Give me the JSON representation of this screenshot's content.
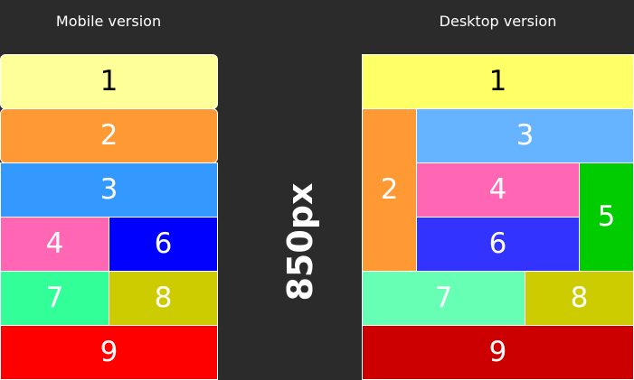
{
  "titles": {
    "mobile": "Mobile version",
    "desktop": "Desktop version"
  },
  "breakpoint": "850px",
  "mobile": {
    "cells": [
      {
        "label": "1",
        "color": "#ffff99"
      },
      {
        "label": "2",
        "color": "#ff9933"
      },
      {
        "label": "3",
        "color": "#3399ff"
      },
      {
        "label": "4",
        "color": "#ff66b3"
      },
      {
        "label": "6",
        "color": "#0000ff"
      },
      {
        "label": "7",
        "color": "#33ff99"
      },
      {
        "label": "8",
        "color": "#cccc00"
      },
      {
        "label": "9",
        "color": "#ff0000"
      }
    ]
  },
  "desktop": {
    "cells": [
      {
        "label": "1",
        "color": "#ffff66"
      },
      {
        "label": "2",
        "color": "#ff9933"
      },
      {
        "label": "3",
        "color": "#66b3ff"
      },
      {
        "label": "4",
        "color": "#ff66b3"
      },
      {
        "label": "5",
        "color": "#00cc00"
      },
      {
        "label": "6",
        "color": "#3333ff"
      },
      {
        "label": "7",
        "color": "#66ffb3"
      },
      {
        "label": "8",
        "color": "#cccc00"
      },
      {
        "label": "9",
        "color": "#cc0000"
      }
    ]
  }
}
